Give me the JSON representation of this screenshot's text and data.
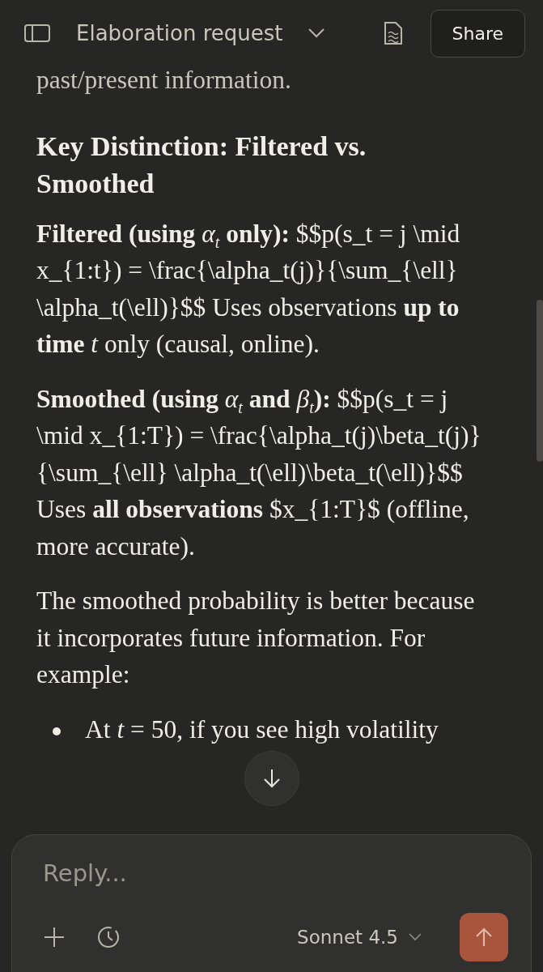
{
  "header": {
    "title": "Elaboration request",
    "share": "Share"
  },
  "content": [
    {
      "kind": "paragraph",
      "text": "past/present information."
    },
    {
      "kind": "heading",
      "text": "Key Distinction: Filtered vs. Smoothed"
    },
    {
      "kind": "paragraph",
      "text": "**Filtered (using** *α*$_{t}$ **only):** $$p(s_t = j \\mid x_{1:t}) = \\frac{\\alpha_t(j)}{\\sum_{\\ell} \\alpha_t(\\ell)}$$ Uses observations **up to time** *t* only (causal, online)."
    },
    {
      "kind": "paragraph",
      "text": "**Smoothed (using** *α*$_{t}$ **and** *β*$_{t}$**):** $$p(s_t = j \\mid x_{1:T}) = \\frac{\\alpha_t(j)\\beta_t(j)}{\\sum_{\\ell} \\alpha_t(\\ell)\\beta_t(\\ell)}$$ Uses **all observations** $x_{1:T}$ (offline, more accurate)."
    },
    {
      "kind": "paragraph",
      "text": "The smoothed probability is better because it incorporates future information. For example:"
    },
    {
      "kind": "bullet",
      "text": "At *t* = 50, if you see high volatility"
    }
  ],
  "composer": {
    "placeholder": "Reply...",
    "model": "Sonnet 4.5"
  }
}
